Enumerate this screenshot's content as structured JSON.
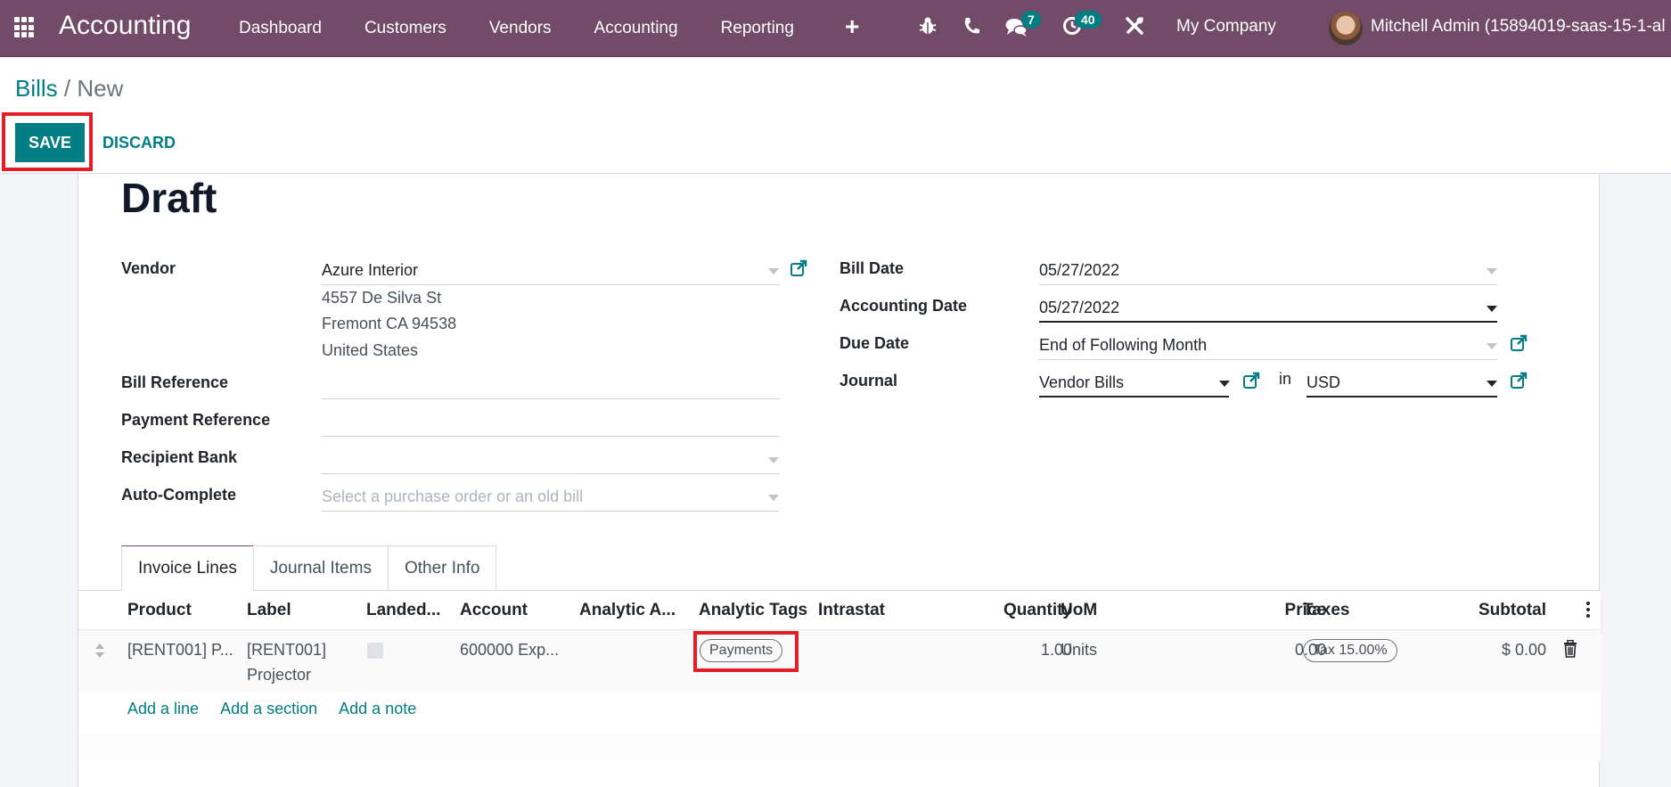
{
  "navbar": {
    "app_name": "Accounting",
    "menu": [
      "Dashboard",
      "Customers",
      "Vendors",
      "Accounting",
      "Reporting"
    ],
    "icons": [
      "apps-grid-icon",
      "plus-icon",
      "bug-icon",
      "phone-icon",
      "chat-icon",
      "activity-clock-icon",
      "tools-icon"
    ],
    "messages_badge": "7",
    "activities_badge": "40",
    "company": "My Company",
    "user": "Mitchell Admin (15894019-saas-15-1-al"
  },
  "breadcrumb": {
    "parent": "Bills",
    "separator": " / ",
    "current": "New"
  },
  "buttons": {
    "save": "SAVE",
    "discard": "DISCARD"
  },
  "form": {
    "status": "Draft",
    "left": {
      "vendor_label": "Vendor",
      "vendor_value": "Azure Interior",
      "vendor_address": [
        "4557 De Silva St",
        "Fremont CA 94538",
        "United States"
      ],
      "bill_reference_label": "Bill Reference",
      "bill_reference_value": "",
      "payment_reference_label": "Payment Reference",
      "payment_reference_value": "",
      "recipient_bank_label": "Recipient Bank",
      "recipient_bank_value": "",
      "auto_complete_label": "Auto-Complete",
      "auto_complete_placeholder": "Select a purchase order or an old bill"
    },
    "right": {
      "bill_date_label": "Bill Date",
      "bill_date_value": "05/27/2022",
      "accounting_date_label": "Accounting Date",
      "accounting_date_value": "05/27/2022",
      "due_date_label": "Due Date",
      "due_date_value": "End of Following Month",
      "journal_label": "Journal",
      "journal_value": "Vendor Bills",
      "in_label": "in",
      "currency_value": "USD"
    }
  },
  "tabs": [
    {
      "label": "Invoice Lines",
      "active": true
    },
    {
      "label": "Journal Items",
      "active": false
    },
    {
      "label": "Other Info",
      "active": false
    }
  ],
  "invoice_lines": {
    "columns": [
      "Product",
      "Label",
      "Landed...",
      "Account",
      "Analytic A...",
      "Analytic Tags",
      "Intrastat",
      "Quantity",
      "UoM",
      "Price",
      "Taxes",
      "Subtotal"
    ],
    "rows": [
      {
        "product": "[RENT001] P...",
        "label_line1": "[RENT001]",
        "label_line2": "Projector",
        "landed": false,
        "account": "600000 Exp...",
        "analytic_account": "",
        "analytic_tag": "Payments",
        "intrastat": "",
        "quantity": "1.00",
        "uom": "Units",
        "price": "0.00",
        "tax": "Tax 15.00%",
        "subtotal": "$ 0.00"
      }
    ],
    "add_links": [
      "Add a line",
      "Add a section",
      "Add a note"
    ]
  },
  "colors": {
    "navbar": "#714B67",
    "primary": "#017e84",
    "highlight": "#e41e26"
  }
}
